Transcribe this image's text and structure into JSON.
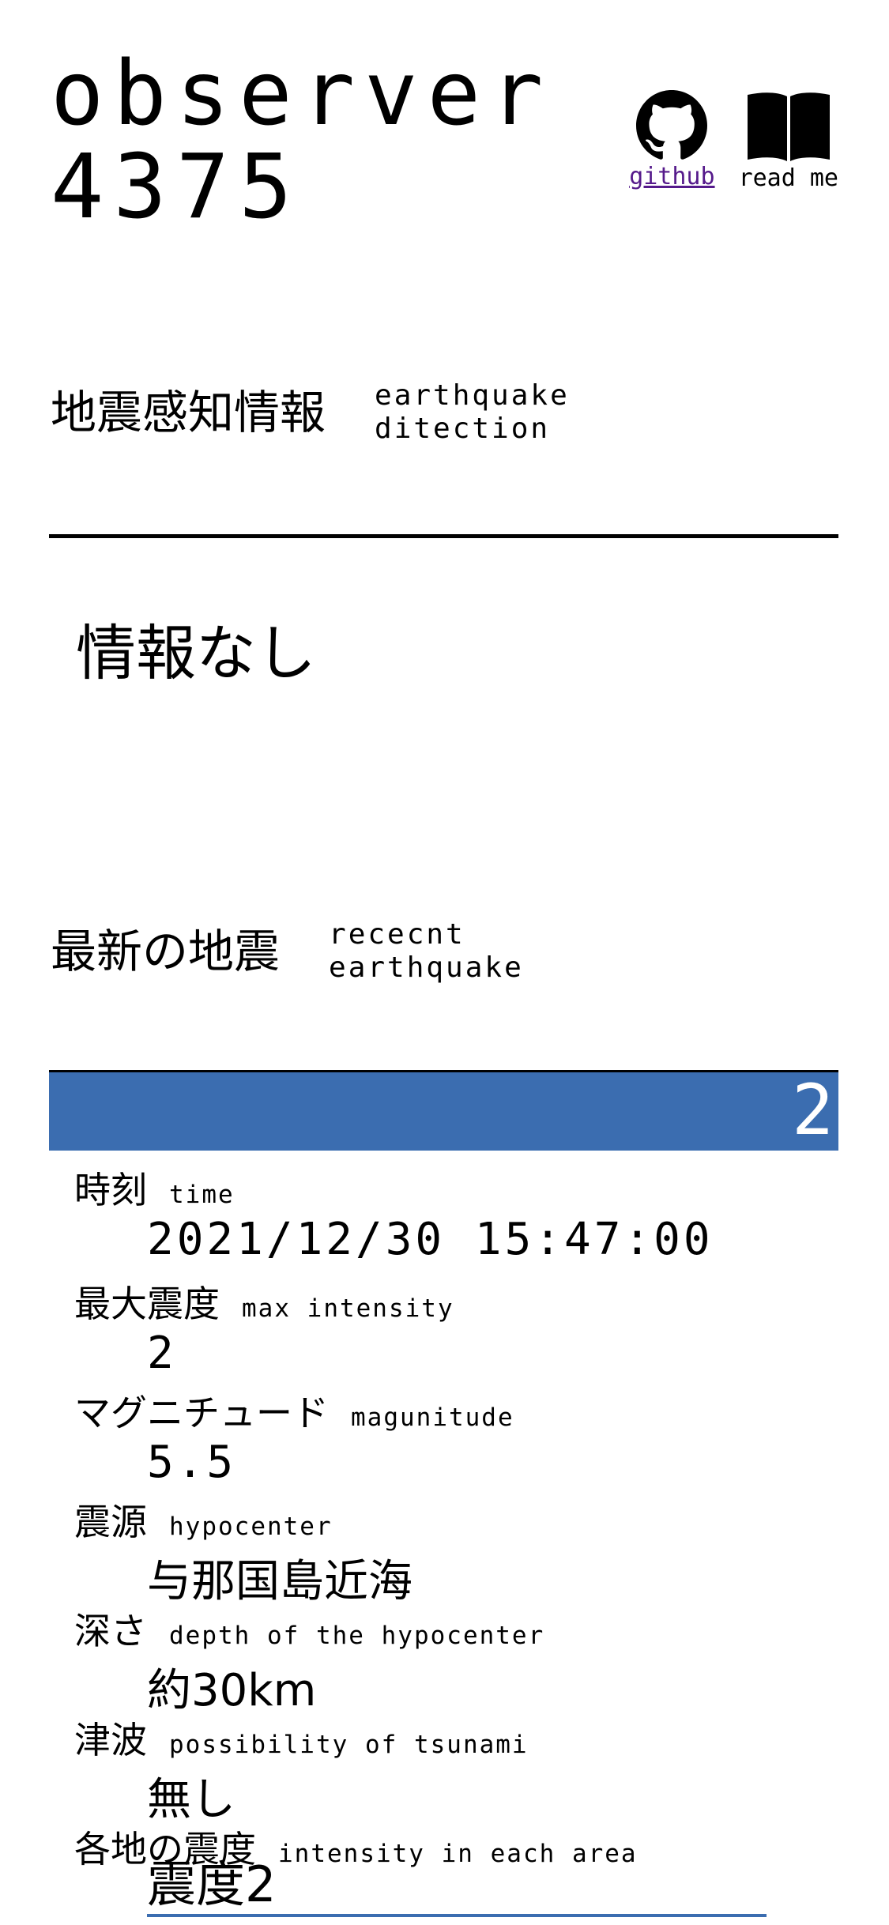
{
  "header": {
    "title_line1": "observer",
    "title_line2": "4375",
    "github_label": "github",
    "readme_label": "read me"
  },
  "detection": {
    "title_jp": "地震感知情報",
    "title_en": "earthquake\nditection",
    "status": "情報なし"
  },
  "recent": {
    "title_jp": "最新の地震",
    "title_en": "rececnt\nearthquake",
    "max_intensity_badge": "2",
    "bar_color": "#3b6db0",
    "fields": {
      "time": {
        "label_jp": "時刻",
        "label_en": "time",
        "value": "2021/12/30 15:47:00"
      },
      "max_intensity": {
        "label_jp": "最大震度",
        "label_en": "max intensity",
        "value": "2"
      },
      "magnitude": {
        "label_jp": "マグニチュード",
        "label_en": "magunitude",
        "value": "5.5"
      },
      "hypocenter": {
        "label_jp": "震源",
        "label_en": "hypocenter",
        "value": "与那国島近海"
      },
      "depth": {
        "label_jp": "深さ",
        "label_en": "depth of the hypocenter",
        "value": "約30km"
      },
      "tsunami": {
        "label_jp": "津波",
        "label_en": "possibility of tsunami",
        "value": "無し"
      },
      "areas": {
        "label_jp": "各地の震度",
        "label_en": "intensity in each area"
      }
    },
    "area_groups": [
      {
        "intensity_label": "震度2"
      }
    ]
  },
  "icons": [
    "github-icon",
    "book-icon"
  ]
}
